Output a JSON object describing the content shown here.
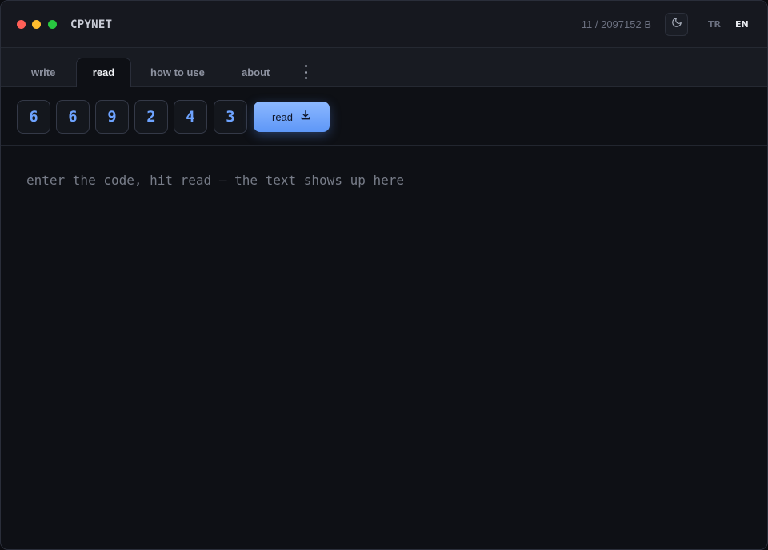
{
  "window": {
    "title": "CPYNET",
    "byte_counter": "11 / 2097152 B",
    "languages": [
      "TR",
      "EN"
    ],
    "active_language": "EN",
    "controls": {
      "close": "#ff5f57",
      "minimize": "#febc2e",
      "maximize": "#28c840"
    }
  },
  "tabs": {
    "write": "write",
    "read": "read",
    "how_to_use": "how to use",
    "about": "about",
    "active": "read"
  },
  "code": {
    "digits": [
      "6",
      "6",
      "9",
      "2",
      "4",
      "3"
    ],
    "read_button": "read"
  },
  "output": {
    "placeholder": "enter the code, hit read — the text shows up here"
  },
  "colors": {
    "accent": "#6ea3ff",
    "button_gradient_top": "#8cb8ff",
    "button_gradient_bottom": "#5e97f7"
  },
  "icons": {
    "theme": "moon-icon",
    "menu": "more-vertical-icon",
    "read": "download-icon"
  }
}
